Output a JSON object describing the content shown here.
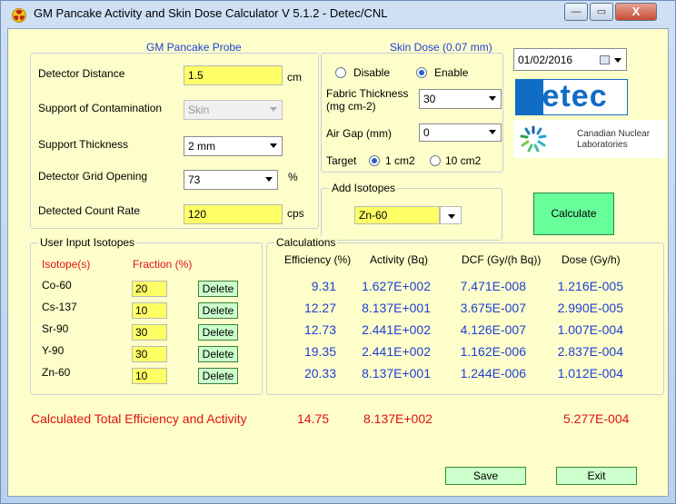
{
  "window": {
    "title": "GM Pancake Activity and Skin Dose Calculator V 5.1.2 - Detec/CNL",
    "minimize": "—",
    "maximize": "▭",
    "close": "X"
  },
  "probe": {
    "title": "GM Pancake Probe",
    "detector_distance_label": "Detector Distance",
    "detector_distance_value": "1.5",
    "detector_distance_unit": "cm",
    "support_contamination_label": "Support of Contamination",
    "support_contamination_value": "Skin",
    "support_thickness_label": "Support Thickness",
    "support_thickness_value": "2 mm",
    "grid_opening_label": "Detector Grid Opening",
    "grid_opening_value": "73",
    "grid_opening_unit": "%",
    "count_rate_label": "Detected Count Rate",
    "count_rate_value": "120",
    "count_rate_unit": "cps"
  },
  "skin_dose": {
    "title": "Skin Dose (0.07 mm)",
    "disable_label": "Disable",
    "enable_label": "Enable",
    "enabled": true,
    "fabric_label_1": "Fabric Thickness",
    "fabric_label_2": "(mg cm-2)",
    "fabric_value": "30",
    "air_gap_label": "Air Gap (mm)",
    "air_gap_value": "0",
    "target_label": "Target",
    "target_1": "1 cm2",
    "target_2": "10 cm2",
    "target_selected": "1 cm2"
  },
  "date": {
    "value": "01/02/2016"
  },
  "logos": {
    "detec": "Detec",
    "cnl_line1": "Canadian Nuclear",
    "cnl_line2": "Laboratories"
  },
  "add_isotopes": {
    "title": "Add Isotopes",
    "value": "Zn-60"
  },
  "calculate_label": "Calculate",
  "user_isotopes": {
    "title": "User Input Isotopes",
    "col_isotope": "Isotope(s)",
    "col_fraction": "Fraction (%)",
    "delete_label": "Delete",
    "rows": [
      {
        "isotope": "Co-60",
        "fraction": "20"
      },
      {
        "isotope": "Cs-137",
        "fraction": "10"
      },
      {
        "isotope": "Sr-90",
        "fraction": "30"
      },
      {
        "isotope": "Y-90",
        "fraction": "30"
      },
      {
        "isotope": "Zn-60",
        "fraction": "10"
      }
    ]
  },
  "calculations": {
    "title": "Calculations",
    "col_efficiency": "Efficiency (%)",
    "col_activity": "Activity (Bq)",
    "col_dcf": "DCF (Gy/(h Bq))",
    "col_dose": "Dose (Gy/h)",
    "rows": [
      {
        "efficiency": "9.31",
        "activity": "1.627E+002",
        "dcf": "7.471E-008",
        "dose": "1.216E-005"
      },
      {
        "efficiency": "12.27",
        "activity": "8.137E+001",
        "dcf": "3.675E-007",
        "dose": "2.990E-005"
      },
      {
        "efficiency": "12.73",
        "activity": "2.441E+002",
        "dcf": "4.126E-007",
        "dose": "1.007E-004"
      },
      {
        "efficiency": "19.35",
        "activity": "2.441E+002",
        "dcf": "1.162E-006",
        "dose": "2.837E-004"
      },
      {
        "efficiency": "20.33",
        "activity": "8.137E+001",
        "dcf": "1.244E-006",
        "dose": "1.012E-004"
      }
    ]
  },
  "totals": {
    "label": "Calculated Total Efficiency and  Activity",
    "efficiency": "14.75",
    "activity": "8.137E+002",
    "dose": "5.277E-004"
  },
  "buttons": {
    "save": "Save",
    "exit": "Exit"
  },
  "colors": {
    "background": "#fefeca",
    "field_yellow": "#ffff66",
    "value_blue": "#1f3fd8",
    "total_red": "#e01010",
    "button_green": "#ccffcc"
  }
}
